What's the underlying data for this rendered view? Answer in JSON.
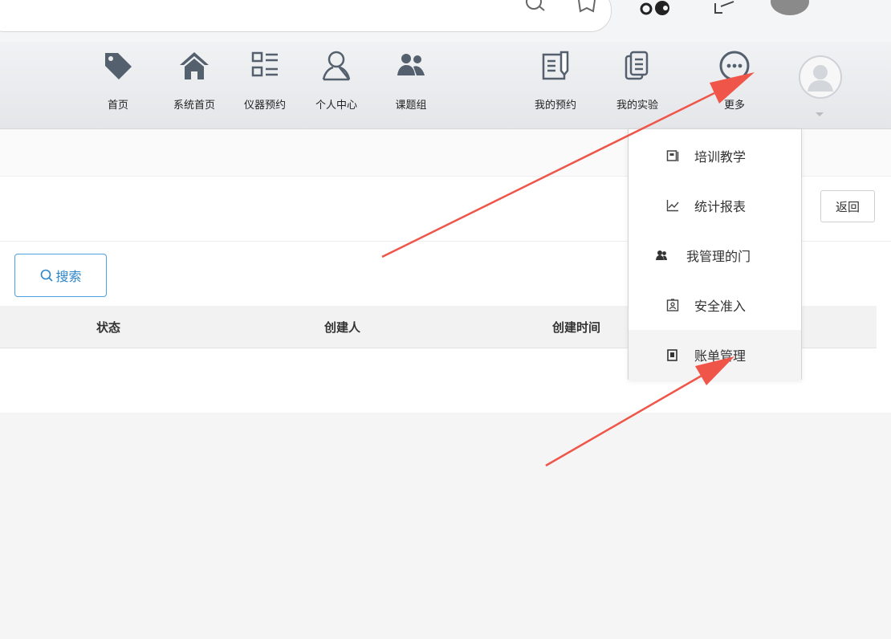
{
  "nav": {
    "items": [
      {
        "label": "首页",
        "icon": "tag-icon"
      },
      {
        "label": "系统首页",
        "icon": "home-icon"
      },
      {
        "label": "仪器预约",
        "icon": "list-icon"
      },
      {
        "label": "个人中心",
        "icon": "user-icon"
      },
      {
        "label": "课题组",
        "icon": "group-icon"
      },
      {
        "label": "我的预约",
        "icon": "note-icon"
      },
      {
        "label": "我的实验",
        "icon": "documents-icon"
      },
      {
        "label": "更多",
        "icon": "more-icon"
      }
    ]
  },
  "dropdown": {
    "items": [
      {
        "label": "培训教学",
        "icon": "book-icon"
      },
      {
        "label": "统计报表",
        "icon": "chart-icon"
      },
      {
        "label": "我管理的门",
        "icon": "group-icon"
      },
      {
        "label": "安全准入",
        "icon": "badge-icon"
      },
      {
        "label": "账单管理",
        "icon": "bill-icon"
      }
    ]
  },
  "toolbar": {
    "back_label": "返回",
    "search_label": "搜索"
  },
  "table": {
    "headers": [
      "状态",
      "创建人",
      "创建时间"
    ]
  },
  "colors": {
    "accent": "#2e86c9",
    "annotation_arrow": "#f0554a",
    "nav_icon": "#54606e"
  }
}
